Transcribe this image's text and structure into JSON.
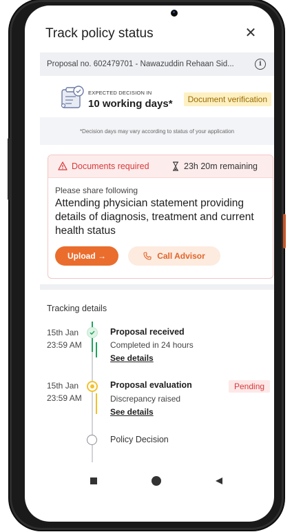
{
  "header": {
    "title": "Track policy status",
    "close_icon": "close-icon"
  },
  "proposal": {
    "text": "Proposal no. 602479701 - Nawazuddin Rehaan Sid...",
    "info_icon": "info-icon"
  },
  "decision": {
    "label": "EXPECTED DECISION IN",
    "value": "10 working days*",
    "badge": "Document verification",
    "note": "*Decision days may vary according to status of your application"
  },
  "documents_card": {
    "title": "Documents required",
    "remaining": "23h 20m remaining",
    "share_label": "Please share following",
    "share_detail": "Attending physician statement providing details of diagnosis, treatment and current health status",
    "upload_label": "Upload →",
    "call_label": "Call Advisor"
  },
  "tracking": {
    "title": "Tracking details",
    "steps": [
      {
        "date": "15th Jan",
        "time": "23:59 AM",
        "name": "Proposal received",
        "sub": "Completed in 24 hours",
        "link": "See details",
        "status": "done"
      },
      {
        "date": "15th Jan",
        "time": "23:59 AM",
        "name": "Proposal evaluation",
        "sub": "Discrepancy raised",
        "link": "See details",
        "status": "pending",
        "badge": "Pending"
      },
      {
        "name": "Policy Decision",
        "status": "upcoming"
      }
    ]
  },
  "colors": {
    "accent": "#ea6d2e",
    "success": "#1fa35c",
    "warning": "#f2c12e",
    "danger": "#d63a3a"
  }
}
